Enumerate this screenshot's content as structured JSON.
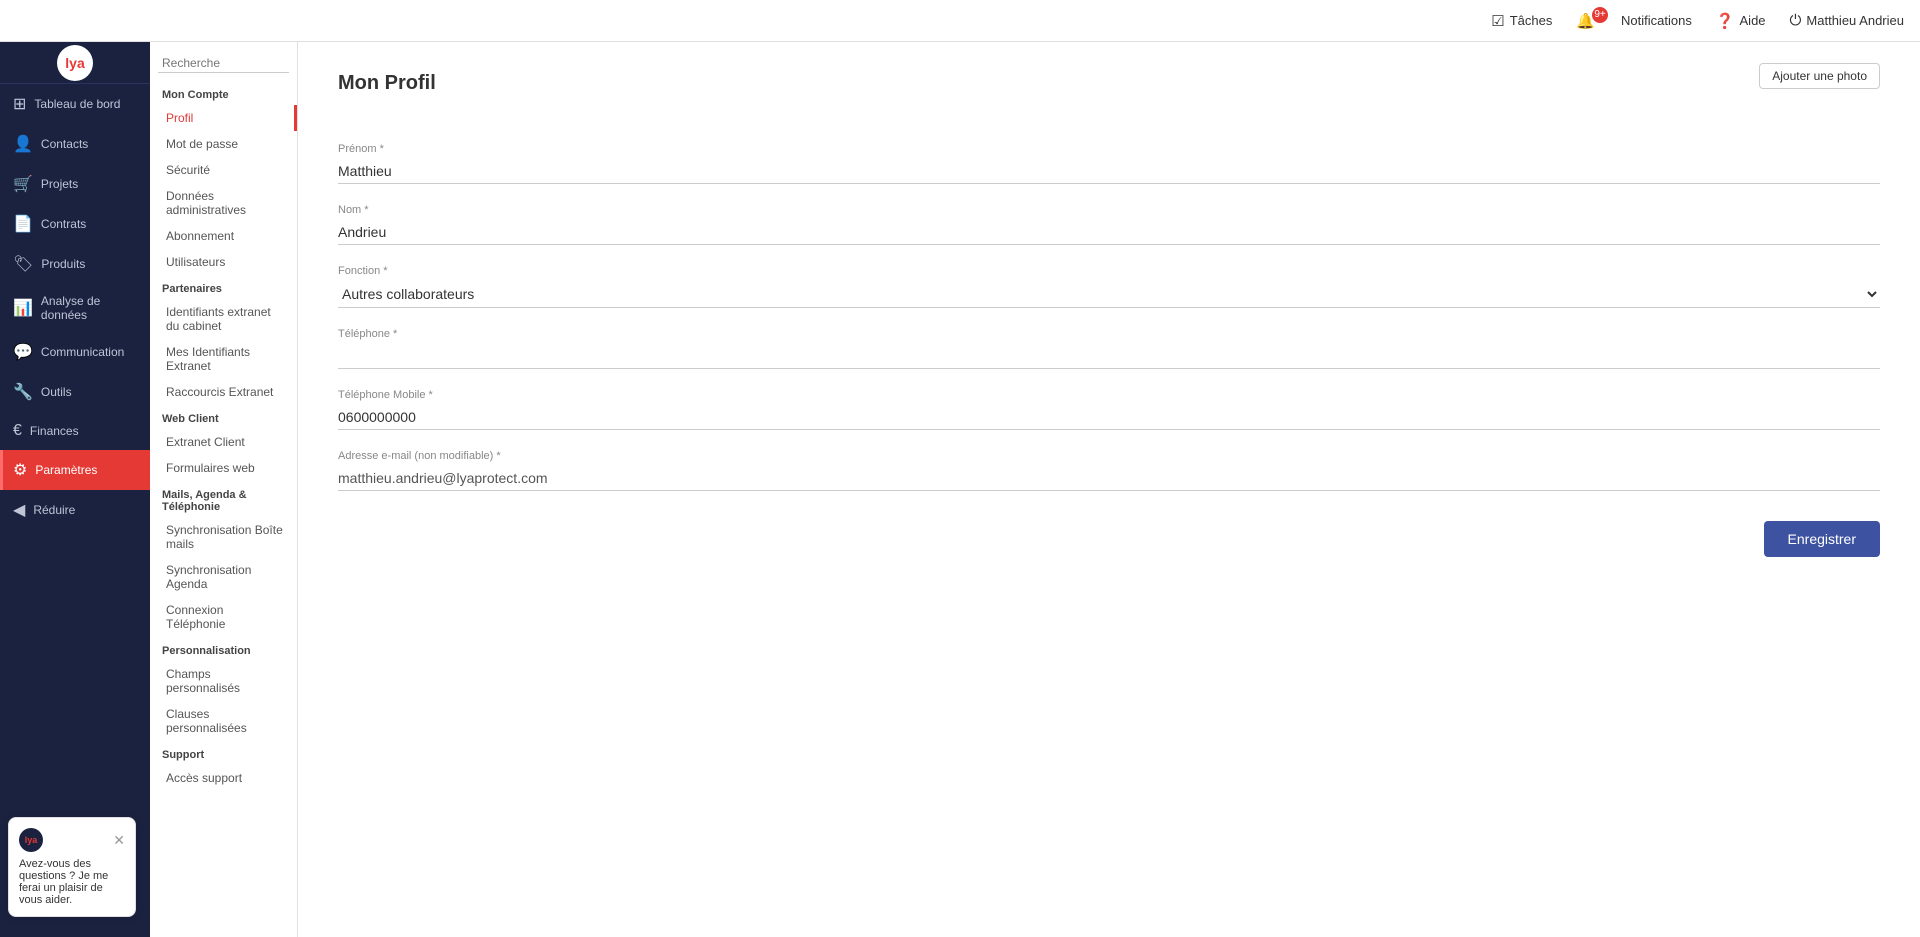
{
  "topbar": {
    "search_placeholder": "Recherche",
    "tasks_label": "Tâches",
    "notifications_label": "Notifications",
    "notifications_count": "9+",
    "help_label": "Aide",
    "user_label": "Matthieu Andrieu"
  },
  "sidebar": {
    "logo_text": "lya",
    "items": [
      {
        "id": "tableau-de-bord",
        "label": "Tableau de bord",
        "icon": "⊞"
      },
      {
        "id": "contacts",
        "label": "Contacts",
        "icon": "👤"
      },
      {
        "id": "projets",
        "label": "Projets",
        "icon": "🛒"
      },
      {
        "id": "contrats",
        "label": "Contrats",
        "icon": "📄"
      },
      {
        "id": "produits",
        "label": "Produits",
        "icon": "🏷"
      },
      {
        "id": "analyse",
        "label": "Analyse de données",
        "icon": "📊"
      },
      {
        "id": "communication",
        "label": "Communication",
        "icon": "💬"
      },
      {
        "id": "outils",
        "label": "Outils",
        "icon": "🔧"
      },
      {
        "id": "finances",
        "label": "Finances",
        "icon": "€"
      },
      {
        "id": "parametres",
        "label": "Paramètres",
        "icon": "⚙"
      },
      {
        "id": "reduire",
        "label": "Réduire",
        "icon": "◀"
      }
    ]
  },
  "secondary_sidebar": {
    "sections": [
      {
        "title": "Mon Compte",
        "items": [
          {
            "id": "profil",
            "label": "Profil",
            "active": true
          },
          {
            "id": "mot-de-passe",
            "label": "Mot de passe",
            "active": false
          },
          {
            "id": "securite",
            "label": "Sécurité",
            "active": false
          },
          {
            "id": "donnees-admin",
            "label": "Données administratives",
            "active": false
          },
          {
            "id": "abonnement",
            "label": "Abonnement",
            "active": false
          },
          {
            "id": "utilisateurs",
            "label": "Utilisateurs",
            "active": false
          }
        ]
      },
      {
        "title": "Partenaires",
        "items": [
          {
            "id": "identifiants-extranet",
            "label": "Identifiants extranet du cabinet",
            "active": false
          },
          {
            "id": "mes-identifiants",
            "label": "Mes Identifiants Extranet",
            "active": false
          },
          {
            "id": "raccourcis-extranet",
            "label": "Raccourcis Extranet",
            "active": false
          }
        ]
      },
      {
        "title": "Web Client",
        "items": [
          {
            "id": "extranet-client",
            "label": "Extranet Client",
            "active": false
          },
          {
            "id": "formulaires-web",
            "label": "Formulaires web",
            "active": false
          }
        ]
      },
      {
        "title": "Mails, Agenda & Téléphonie",
        "items": [
          {
            "id": "synchro-boite",
            "label": "Synchronisation Boîte mails",
            "active": false
          },
          {
            "id": "synchro-agenda",
            "label": "Synchronisation Agenda",
            "active": false
          },
          {
            "id": "connexion-tel",
            "label": "Connexion Téléphonie",
            "active": false
          }
        ]
      },
      {
        "title": "Personnalisation",
        "items": [
          {
            "id": "champs-personnalises",
            "label": "Champs personnalisés",
            "active": false
          },
          {
            "id": "clauses-personnalisees",
            "label": "Clauses personnalisées",
            "active": false
          }
        ]
      },
      {
        "title": "Support",
        "items": [
          {
            "id": "acces-support",
            "label": "Accès support",
            "active": false
          }
        ]
      }
    ]
  },
  "form": {
    "page_title": "Mon Profil",
    "add_photo_label": "Ajouter une photo",
    "fields": {
      "prenom_label": "Prénom *",
      "prenom_value": "Matthieu",
      "nom_label": "Nom *",
      "nom_value": "Andrieu",
      "fonction_label": "Fonction *",
      "fonction_value": "Autres collaborateurs",
      "telephone_label": "Téléphone *",
      "telephone_value": "",
      "telephone_mobile_label": "Téléphone Mobile *",
      "telephone_mobile_value": "0600000000",
      "email_label": "Adresse e-mail (non modifiable) *",
      "email_value": "matthieu.andrieu@lyaprotect.com"
    },
    "save_label": "Enregistrer"
  },
  "chat_bubble": {
    "text": "Avez-vous des questions ? Je me ferai un plaisir de vous aider.",
    "logo_text": "lya"
  }
}
